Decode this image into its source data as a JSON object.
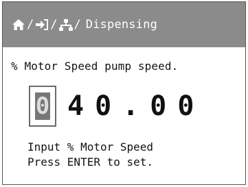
{
  "header": {
    "icons": [
      "home-icon",
      "login-arrow-icon",
      "network-icon"
    ],
    "separator": "/",
    "title": "Dispensing"
  },
  "prompt": "% Motor Speed pump speed.",
  "entry": {
    "active_digit": "0",
    "remaining_digits": "40.00"
  },
  "help": {
    "line1": "Input % Motor Speed",
    "line2": "Press ENTER to set."
  },
  "colors": {
    "titlebar": "#8b8b8b",
    "cursor_fill": "#777777",
    "text": "#111111"
  }
}
